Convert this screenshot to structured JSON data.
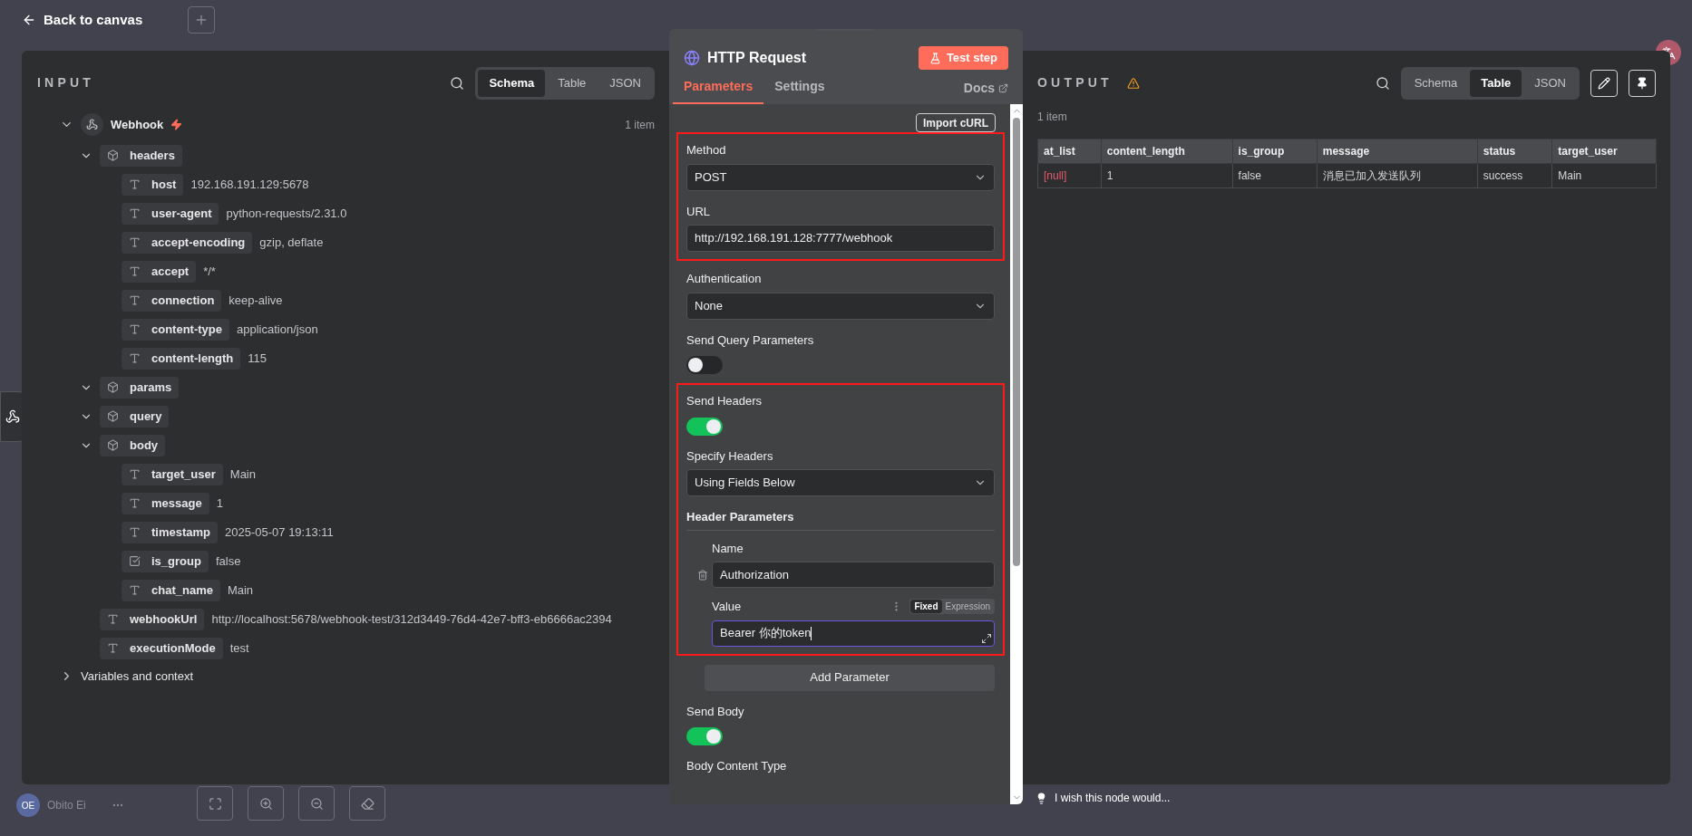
{
  "top_bar": {
    "back_label": "Back to canvas"
  },
  "input": {
    "title": "INPUT",
    "view_tabs": [
      {
        "label": "Schema",
        "selected": true
      },
      {
        "label": "Table",
        "selected": false
      },
      {
        "label": "JSON",
        "selected": false
      }
    ],
    "tree": {
      "label": "Webhook",
      "count": "1 item",
      "expanded": true,
      "children": [
        {
          "kind": "object",
          "key": "headers",
          "expanded": true,
          "children": [
            {
              "kind": "string",
              "key": "host",
              "value": "192.168.191.129:5678"
            },
            {
              "kind": "string",
              "key": "user-agent",
              "value": "python-requests/2.31.0"
            },
            {
              "kind": "string",
              "key": "accept-encoding",
              "value": "gzip, deflate"
            },
            {
              "kind": "string",
              "key": "accept",
              "value": "*/*"
            },
            {
              "kind": "string",
              "key": "connection",
              "value": "keep-alive"
            },
            {
              "kind": "string",
              "key": "content-type",
              "value": "application/json"
            },
            {
              "kind": "string",
              "key": "content-length",
              "value": "115"
            }
          ]
        },
        {
          "kind": "object",
          "key": "params",
          "expanded": true
        },
        {
          "kind": "object",
          "key": "query",
          "expanded": true
        },
        {
          "kind": "object",
          "key": "body",
          "expanded": true,
          "children": [
            {
              "kind": "string",
              "key": "target_user",
              "value": "Main"
            },
            {
              "kind": "string",
              "key": "message",
              "value": "1"
            },
            {
              "kind": "string",
              "key": "timestamp",
              "value": "2025-05-07 19:13:11"
            },
            {
              "kind": "boolean",
              "key": "is_group",
              "value": "false"
            },
            {
              "kind": "string",
              "key": "chat_name",
              "value": "Main"
            }
          ]
        },
        {
          "kind": "string",
          "key": "webhookUrl",
          "value": "http://localhost:5678/webhook-test/312d3449-76d4-42e7-bff3-eb6666ac2394"
        },
        {
          "kind": "string",
          "key": "executionMode",
          "value": "test"
        }
      ]
    },
    "variables": {
      "label": "Variables and context",
      "expanded": false
    }
  },
  "node_panel": {
    "title": "HTTP Request",
    "test_button": "Test step",
    "tabs": [
      {
        "label": "Parameters",
        "selected": true
      },
      {
        "label": "Settings",
        "selected": false
      }
    ],
    "docs": "Docs",
    "import_button": "Import cURL",
    "groups": [
      {
        "highlighted": true,
        "fields": [
          {
            "kind": "select",
            "label": "Method",
            "value": "POST"
          },
          {
            "kind": "text",
            "label": "URL",
            "value": "http://192.168.191.128:7777/webhook"
          }
        ]
      },
      {
        "highlighted": false,
        "fields": [
          {
            "kind": "select",
            "label": "Authentication",
            "value": "None"
          },
          {
            "kind": "toggle",
            "label": "Send Query Parameters",
            "on": false
          }
        ]
      },
      {
        "highlighted": true,
        "fields": [
          {
            "kind": "toggle",
            "label": "Send Headers",
            "on": true
          },
          {
            "kind": "select",
            "label": "Specify Headers",
            "value": "Using Fields Below"
          },
          {
            "kind": "collection",
            "label": "Header Parameters",
            "name_label": "Name",
            "name_value": "Authorization",
            "value_label": "Value",
            "value": "Bearer 你的token",
            "focused": true,
            "modes": [
              {
                "label": "Fixed",
                "selected": true
              },
              {
                "label": "Expression",
                "selected": false
              }
            ]
          }
        ]
      },
      {
        "highlighted": false,
        "fields": [
          {
            "kind": "button",
            "label": "Add Parameter"
          },
          {
            "kind": "toggle",
            "label": "Send Body",
            "on": true
          },
          {
            "kind": "heading",
            "label": "Body Content Type"
          }
        ]
      }
    ]
  },
  "output": {
    "title": "OUTPUT",
    "view_tabs": [
      {
        "label": "Schema",
        "selected": false
      },
      {
        "label": "Table",
        "selected": true
      },
      {
        "label": "JSON",
        "selected": false
      }
    ],
    "count": "1 item",
    "table": {
      "columns": [
        "at_list",
        "content_length",
        "is_group",
        "message",
        "status",
        "target_user"
      ],
      "rows": [
        [
          {
            "kind": "null",
            "text": "[null]"
          },
          {
            "kind": "value",
            "text": "1"
          },
          {
            "kind": "value",
            "text": "false"
          },
          {
            "kind": "value",
            "text": "消息已加入发送队列"
          },
          {
            "kind": "value",
            "text": "success"
          },
          {
            "kind": "value",
            "text": "Main"
          }
        ]
      ]
    }
  },
  "bottom": {
    "user_initials": "OE",
    "user_name": "Obito Ei",
    "feedback": "I wish this node would..."
  }
}
